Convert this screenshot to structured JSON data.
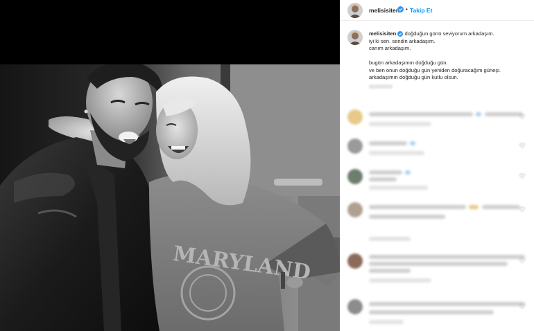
{
  "post": {
    "username": "melisisiten",
    "follow_label": "Takip Et",
    "separator": "•",
    "caption": {
      "username": "melisisiten",
      "lines": [
        "doğduğun günü seviyorum arkadaşım.",
        "iyi ki sen. sendin arkadaşım.",
        "canım arkadaşım.",
        "",
        "bugün arkadaşımın doğduğu gün.",
        "ve ben onun doğduğu gün yeniden doğuracağım güneşi.",
        "arkadaşımın doğduğu gün kutlu olsun."
      ]
    },
    "photo": {
      "sweatshirt_text": "MARYLAND"
    }
  },
  "colors": {
    "accent": "#0095f6",
    "verified": "#3897f0",
    "text": "#262626",
    "divider": "#efefef"
  },
  "icons": [
    "verified-badge-icon",
    "heart-icon"
  ]
}
